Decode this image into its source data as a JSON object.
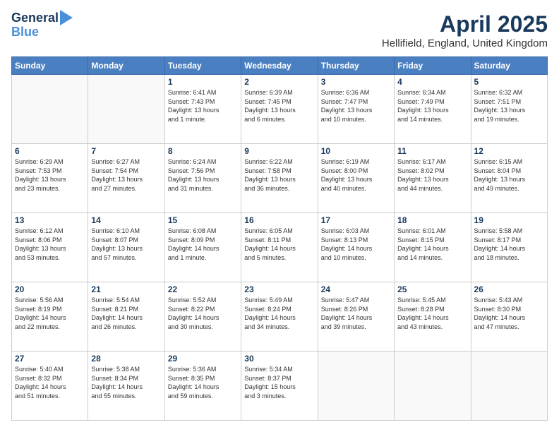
{
  "header": {
    "logo_line1": "General",
    "logo_line2": "Blue",
    "month": "April 2025",
    "location": "Hellifield, England, United Kingdom"
  },
  "days_of_week": [
    "Sunday",
    "Monday",
    "Tuesday",
    "Wednesday",
    "Thursday",
    "Friday",
    "Saturday"
  ],
  "weeks": [
    [
      {
        "day": "",
        "info": ""
      },
      {
        "day": "",
        "info": ""
      },
      {
        "day": "1",
        "info": "Sunrise: 6:41 AM\nSunset: 7:43 PM\nDaylight: 13 hours\nand 1 minute."
      },
      {
        "day": "2",
        "info": "Sunrise: 6:39 AM\nSunset: 7:45 PM\nDaylight: 13 hours\nand 6 minutes."
      },
      {
        "day": "3",
        "info": "Sunrise: 6:36 AM\nSunset: 7:47 PM\nDaylight: 13 hours\nand 10 minutes."
      },
      {
        "day": "4",
        "info": "Sunrise: 6:34 AM\nSunset: 7:49 PM\nDaylight: 13 hours\nand 14 minutes."
      },
      {
        "day": "5",
        "info": "Sunrise: 6:32 AM\nSunset: 7:51 PM\nDaylight: 13 hours\nand 19 minutes."
      }
    ],
    [
      {
        "day": "6",
        "info": "Sunrise: 6:29 AM\nSunset: 7:53 PM\nDaylight: 13 hours\nand 23 minutes."
      },
      {
        "day": "7",
        "info": "Sunrise: 6:27 AM\nSunset: 7:54 PM\nDaylight: 13 hours\nand 27 minutes."
      },
      {
        "day": "8",
        "info": "Sunrise: 6:24 AM\nSunset: 7:56 PM\nDaylight: 13 hours\nand 31 minutes."
      },
      {
        "day": "9",
        "info": "Sunrise: 6:22 AM\nSunset: 7:58 PM\nDaylight: 13 hours\nand 36 minutes."
      },
      {
        "day": "10",
        "info": "Sunrise: 6:19 AM\nSunset: 8:00 PM\nDaylight: 13 hours\nand 40 minutes."
      },
      {
        "day": "11",
        "info": "Sunrise: 6:17 AM\nSunset: 8:02 PM\nDaylight: 13 hours\nand 44 minutes."
      },
      {
        "day": "12",
        "info": "Sunrise: 6:15 AM\nSunset: 8:04 PM\nDaylight: 13 hours\nand 49 minutes."
      }
    ],
    [
      {
        "day": "13",
        "info": "Sunrise: 6:12 AM\nSunset: 8:06 PM\nDaylight: 13 hours\nand 53 minutes."
      },
      {
        "day": "14",
        "info": "Sunrise: 6:10 AM\nSunset: 8:07 PM\nDaylight: 13 hours\nand 57 minutes."
      },
      {
        "day": "15",
        "info": "Sunrise: 6:08 AM\nSunset: 8:09 PM\nDaylight: 14 hours\nand 1 minute."
      },
      {
        "day": "16",
        "info": "Sunrise: 6:05 AM\nSunset: 8:11 PM\nDaylight: 14 hours\nand 5 minutes."
      },
      {
        "day": "17",
        "info": "Sunrise: 6:03 AM\nSunset: 8:13 PM\nDaylight: 14 hours\nand 10 minutes."
      },
      {
        "day": "18",
        "info": "Sunrise: 6:01 AM\nSunset: 8:15 PM\nDaylight: 14 hours\nand 14 minutes."
      },
      {
        "day": "19",
        "info": "Sunrise: 5:58 AM\nSunset: 8:17 PM\nDaylight: 14 hours\nand 18 minutes."
      }
    ],
    [
      {
        "day": "20",
        "info": "Sunrise: 5:56 AM\nSunset: 8:19 PM\nDaylight: 14 hours\nand 22 minutes."
      },
      {
        "day": "21",
        "info": "Sunrise: 5:54 AM\nSunset: 8:21 PM\nDaylight: 14 hours\nand 26 minutes."
      },
      {
        "day": "22",
        "info": "Sunrise: 5:52 AM\nSunset: 8:22 PM\nDaylight: 14 hours\nand 30 minutes."
      },
      {
        "day": "23",
        "info": "Sunrise: 5:49 AM\nSunset: 8:24 PM\nDaylight: 14 hours\nand 34 minutes."
      },
      {
        "day": "24",
        "info": "Sunrise: 5:47 AM\nSunset: 8:26 PM\nDaylight: 14 hours\nand 39 minutes."
      },
      {
        "day": "25",
        "info": "Sunrise: 5:45 AM\nSunset: 8:28 PM\nDaylight: 14 hours\nand 43 minutes."
      },
      {
        "day": "26",
        "info": "Sunrise: 5:43 AM\nSunset: 8:30 PM\nDaylight: 14 hours\nand 47 minutes."
      }
    ],
    [
      {
        "day": "27",
        "info": "Sunrise: 5:40 AM\nSunset: 8:32 PM\nDaylight: 14 hours\nand 51 minutes."
      },
      {
        "day": "28",
        "info": "Sunrise: 5:38 AM\nSunset: 8:34 PM\nDaylight: 14 hours\nand 55 minutes."
      },
      {
        "day": "29",
        "info": "Sunrise: 5:36 AM\nSunset: 8:35 PM\nDaylight: 14 hours\nand 59 minutes."
      },
      {
        "day": "30",
        "info": "Sunrise: 5:34 AM\nSunset: 8:37 PM\nDaylight: 15 hours\nand 3 minutes."
      },
      {
        "day": "",
        "info": ""
      },
      {
        "day": "",
        "info": ""
      },
      {
        "day": "",
        "info": ""
      }
    ]
  ]
}
